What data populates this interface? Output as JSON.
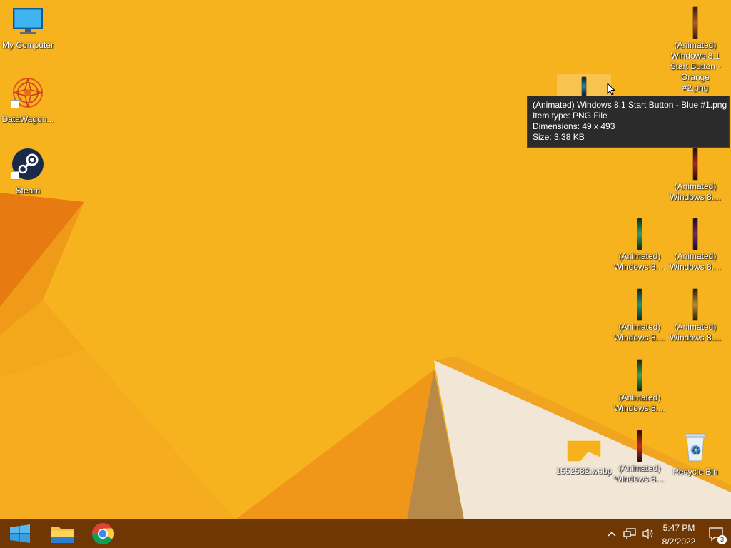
{
  "desktop": {
    "icons": [
      {
        "label": "My Computer"
      },
      {
        "label": "DataWagon..."
      },
      {
        "label": "Steam"
      },
      {
        "label": "(Animated) Windows 8.1 Start Button - Orange #2.png"
      },
      {
        "label": "(Animated) Windows 8...."
      },
      {
        "label": "(Animated) Windows 8...."
      },
      {
        "label": "(Animated) Windows 8...."
      },
      {
        "label": "(Animated) Windows 8...."
      },
      {
        "label": "(Animated) Windows 8...."
      },
      {
        "label": "(Animated) Windows 8...."
      },
      {
        "label": "(Animated) Windows 8...."
      },
      {
        "label": "1552582.webp"
      },
      {
        "label": "Recycle Bin"
      }
    ]
  },
  "tooltip": {
    "name": "(Animated) Windows 8.1 Start Button - Blue #1.png",
    "type": "Item type: PNG File",
    "dimensions": "Dimensions: 49 x 493",
    "size": "Size: 3.38 KB"
  },
  "taskbar": {
    "start_icon": "windows-logo-icon",
    "pinned": [
      {
        "name": "file-explorer-icon"
      },
      {
        "name": "chrome-icon"
      }
    ],
    "tray": {
      "time": "5:47 PM",
      "date": "8/2/2022",
      "notification_count": "3"
    }
  },
  "colors": {
    "wallpaper_orange": "#f6b21c",
    "taskbar": "#6e3703"
  }
}
